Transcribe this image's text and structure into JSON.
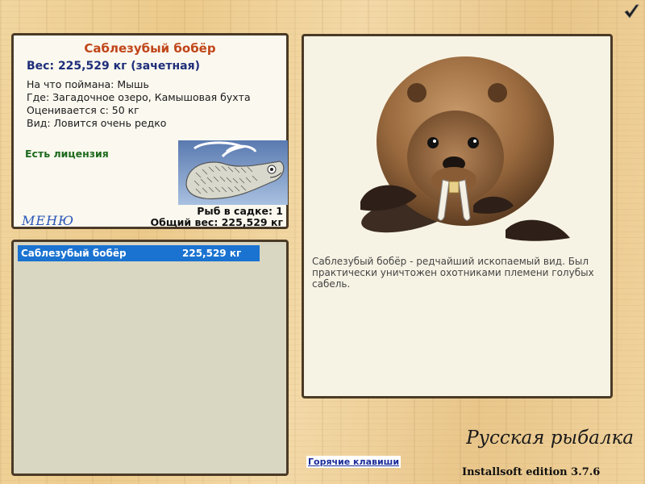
{
  "info": {
    "fish_name": "Саблезубый бобёр",
    "weight_line": "Вес: 225,529 кг (зачетная)",
    "bait": "На что поймана: Мышь",
    "location": "Где: Загадочное озеро, Камышовая бухта",
    "estimated_from": "Оценивается с: 50 кг",
    "species_rarity": "Вид: Ловится очень редко",
    "license": "Есть лицензия",
    "fish_in_cage": "Рыб в садке: 1",
    "total_weight": "Общий вес: 225,529 кг",
    "menu_label": "МЕНЮ"
  },
  "catch_list": [
    {
      "name": "Саблезубый бобёр",
      "weight": "225,529 кг",
      "selected": true
    }
  ],
  "description": "Саблезубый бобёр - редчайший ископаемый вид. Был практически уничтожен охотниками племени голубых сабель.",
  "footer": {
    "hotkeys_label": "Горячие клавиши",
    "brand": "Русская рыбалка",
    "edition": "Installsoft edition 3.7.6"
  },
  "icons": {
    "confirm": "checkmark-icon"
  },
  "colors": {
    "title": "#c0461a",
    "weight": "#1e2e7a",
    "license": "#1e6a1e",
    "selection": "#1a73d1",
    "menu": "#2a56b8"
  }
}
